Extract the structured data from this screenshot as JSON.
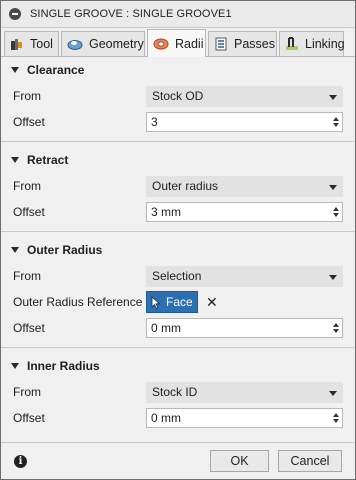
{
  "window": {
    "title": "SINGLE GROOVE : SINGLE GROOVE1"
  },
  "tabs": [
    {
      "label": "Tool",
      "icon": "tool-icon"
    },
    {
      "label": "Geometry",
      "icon": "geometry-icon"
    },
    {
      "label": "Radii",
      "icon": "radii-icon",
      "active": true
    },
    {
      "label": "Passes",
      "icon": "passes-icon"
    },
    {
      "label": "Linking",
      "icon": "linking-icon"
    }
  ],
  "clearance": {
    "header": "Clearance",
    "from_label": "From",
    "from_value": "Stock OD",
    "offset_label": "Offset",
    "offset_value": "3"
  },
  "retract": {
    "header": "Retract",
    "from_label": "From",
    "from_value": "Outer radius",
    "offset_label": "Offset",
    "offset_value": "3 mm"
  },
  "outer_radius": {
    "header": "Outer Radius",
    "from_label": "From",
    "from_value": "Selection",
    "reference_label": "Outer Radius Reference",
    "reference_value": "Face",
    "clear_symbol": "✕",
    "offset_label": "Offset",
    "offset_value": "0 mm"
  },
  "inner_radius": {
    "header": "Inner Radius",
    "from_label": "From",
    "from_value": "Stock ID",
    "offset_label": "Offset",
    "offset_value": "0 mm"
  },
  "footer": {
    "info_glyph": "i",
    "ok_label": "OK",
    "cancel_label": "Cancel"
  },
  "colors": {
    "selection_accent": "#2d6fb1",
    "dialog_bg": "#f0f0f0",
    "dropdown_bg": "#e2e2e2"
  }
}
